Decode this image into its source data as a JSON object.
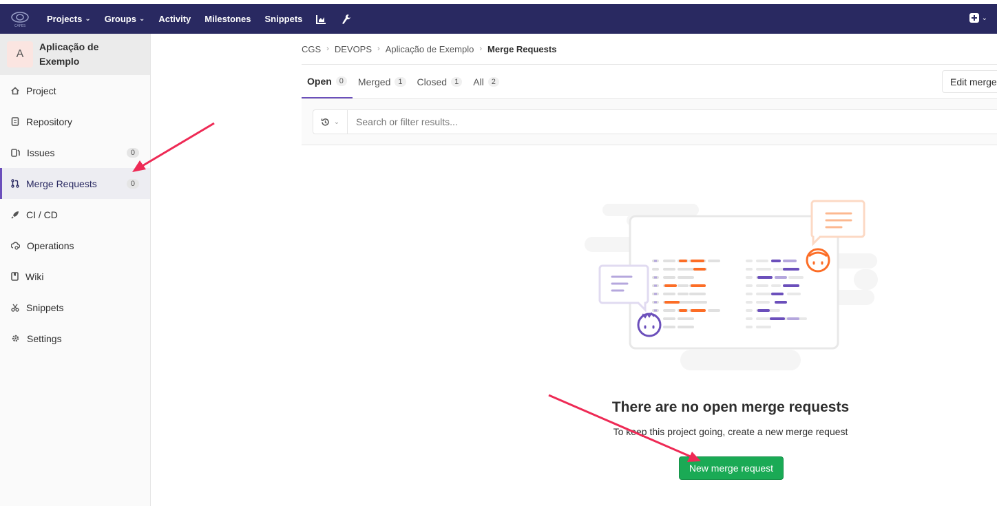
{
  "topbar": {
    "logo_text": "CAPES",
    "nav": [
      {
        "label": "Projects",
        "dropdown": true
      },
      {
        "label": "Groups",
        "dropdown": true
      },
      {
        "label": "Activity",
        "dropdown": false
      },
      {
        "label": "Milestones",
        "dropdown": false
      },
      {
        "label": "Snippets",
        "dropdown": false
      }
    ],
    "icons": [
      "chart-icon",
      "wrench-icon",
      "plus-square-icon"
    ]
  },
  "sidebar": {
    "avatar_letter": "A",
    "project_name": "Aplicação de Exemplo",
    "items": [
      {
        "label": "Project",
        "icon": "home-icon"
      },
      {
        "label": "Repository",
        "icon": "document-icon"
      },
      {
        "label": "Issues",
        "icon": "issues-icon",
        "count": "0"
      },
      {
        "label": "Merge Requests",
        "icon": "merge-request-icon",
        "count": "0",
        "active": true
      },
      {
        "label": "CI / CD",
        "icon": "rocket-icon"
      },
      {
        "label": "Operations",
        "icon": "cloud-gear-icon"
      },
      {
        "label": "Wiki",
        "icon": "book-icon"
      },
      {
        "label": "Snippets",
        "icon": "scissors-icon"
      },
      {
        "label": "Settings",
        "icon": "gear-icon"
      }
    ]
  },
  "breadcrumb": [
    "CGS",
    "DEVOPS",
    "Aplicação de Exemplo",
    "Merge Requests"
  ],
  "tabs": [
    {
      "label": "Open",
      "count": "0",
      "active": true
    },
    {
      "label": "Merged",
      "count": "1"
    },
    {
      "label": "Closed",
      "count": "1"
    },
    {
      "label": "All",
      "count": "2"
    }
  ],
  "edit_button": "Edit merge",
  "search": {
    "placeholder": "Search or filter results..."
  },
  "empty_state": {
    "title": "There are no open merge requests",
    "subtitle": "To keep this project going, create a new merge request",
    "button": "New merge request"
  },
  "colors": {
    "topbar": "#292961",
    "accent": "#6b4fbb",
    "success": "#1aaa55",
    "annotation_arrow": "#ee2a55"
  }
}
